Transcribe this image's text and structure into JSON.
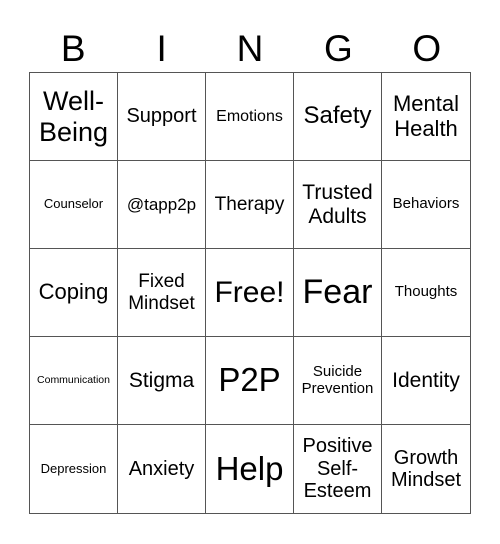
{
  "header": [
    "B",
    "I",
    "N",
    "G",
    "O"
  ],
  "cells": [
    "Well-Being",
    "Support",
    "Emotions",
    "Safety",
    "Mental Health",
    "Counselor",
    "@tapp2p",
    "Therapy",
    "Trusted Adults",
    "Behaviors",
    "Coping",
    "Fixed Mindset",
    "Free!",
    "Fear",
    "Thoughts",
    "Communication",
    "Stigma",
    "P2P",
    "Suicide Prevention",
    "Identity",
    "Depression",
    "Anxiety",
    "Help",
    "Positive Self-Esteem",
    "Growth Mindset"
  ]
}
